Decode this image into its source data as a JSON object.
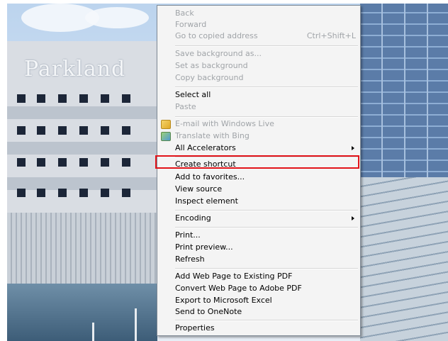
{
  "background": {
    "logo_text": "Parkland"
  },
  "context_menu": {
    "items": [
      {
        "label": "Back",
        "shortcut": "",
        "enabled": false
      },
      {
        "label": "Forward",
        "shortcut": "",
        "enabled": false
      },
      {
        "label": "Go to copied address",
        "shortcut": "Ctrl+Shift+L",
        "enabled": false
      },
      {
        "label": "Save background as...",
        "shortcut": "",
        "enabled": false
      },
      {
        "label": "Set as background",
        "shortcut": "",
        "enabled": false
      },
      {
        "label": "Copy background",
        "shortcut": "",
        "enabled": false
      },
      {
        "label": "Select all",
        "shortcut": "",
        "enabled": true
      },
      {
        "label": "Paste",
        "shortcut": "",
        "enabled": false
      },
      {
        "label": "E-mail with Windows Live",
        "shortcut": "",
        "enabled": false,
        "icon": "windows-live-mail-icon"
      },
      {
        "label": "Translate with Bing",
        "shortcut": "",
        "enabled": false,
        "icon": "bing-translate-icon"
      },
      {
        "label": "All Accelerators",
        "shortcut": "",
        "enabled": true,
        "submenu": true
      },
      {
        "label": "Create shortcut",
        "shortcut": "",
        "enabled": true,
        "highlighted": true
      },
      {
        "label": "Add to favorites...",
        "shortcut": "",
        "enabled": true
      },
      {
        "label": "View source",
        "shortcut": "",
        "enabled": true
      },
      {
        "label": "Inspect element",
        "shortcut": "",
        "enabled": true
      },
      {
        "label": "Encoding",
        "shortcut": "",
        "enabled": true,
        "submenu": true
      },
      {
        "label": "Print...",
        "shortcut": "",
        "enabled": true
      },
      {
        "label": "Print preview...",
        "shortcut": "",
        "enabled": true
      },
      {
        "label": "Refresh",
        "shortcut": "",
        "enabled": true
      },
      {
        "label": "Add Web Page to Existing PDF",
        "shortcut": "",
        "enabled": true
      },
      {
        "label": "Convert Web Page to Adobe PDF",
        "shortcut": "",
        "enabled": true
      },
      {
        "label": "Export to Microsoft Excel",
        "shortcut": "",
        "enabled": true
      },
      {
        "label": "Send to OneNote",
        "shortcut": "",
        "enabled": true
      },
      {
        "label": "Properties",
        "shortcut": "",
        "enabled": true
      }
    ],
    "highlight_color": "#e2141a"
  }
}
